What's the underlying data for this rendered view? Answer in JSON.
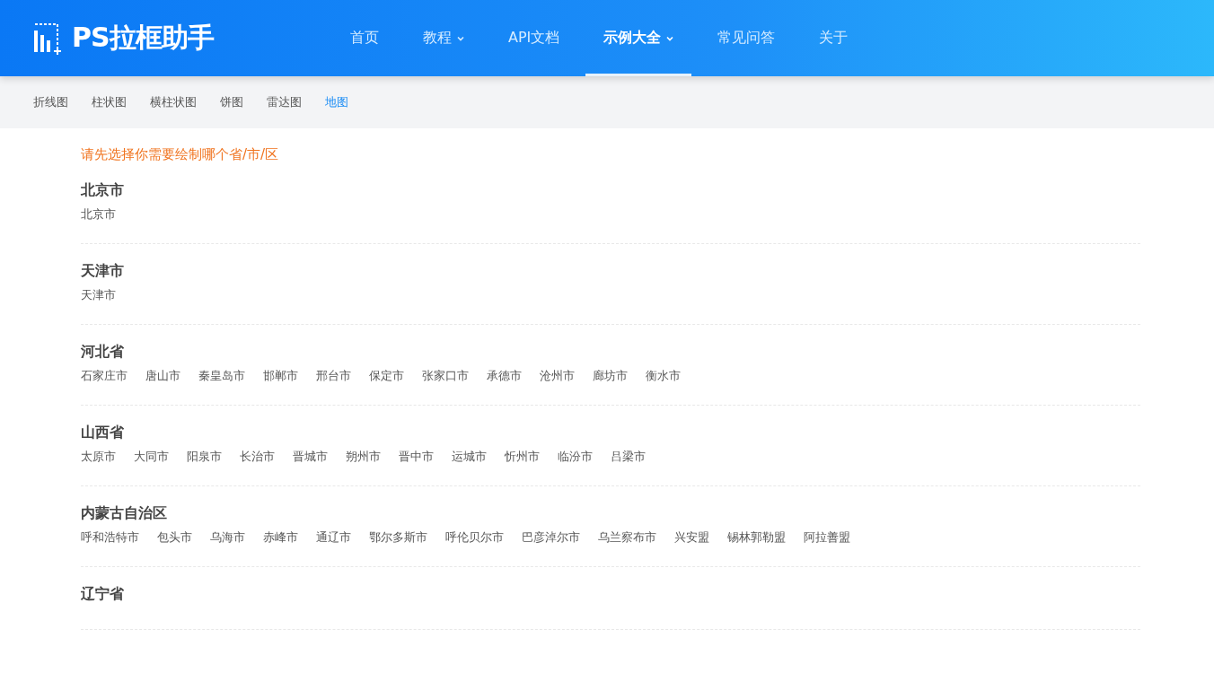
{
  "header": {
    "logo_text": "PS拉框助手",
    "nav": [
      {
        "label": "首页",
        "selected": false,
        "dropdown": false
      },
      {
        "label": "教程",
        "selected": false,
        "dropdown": true
      },
      {
        "label": "API文档",
        "selected": false,
        "dropdown": false
      },
      {
        "label": "示例大全",
        "selected": true,
        "dropdown": true
      },
      {
        "label": "常见问答",
        "selected": false,
        "dropdown": false
      },
      {
        "label": "关于",
        "selected": false,
        "dropdown": false
      }
    ]
  },
  "subnav": [
    {
      "label": "折线图",
      "selected": false
    },
    {
      "label": "柱状图",
      "selected": false
    },
    {
      "label": "横柱状图",
      "selected": false
    },
    {
      "label": "饼图",
      "selected": false
    },
    {
      "label": "雷达图",
      "selected": false
    },
    {
      "label": "地图",
      "selected": true
    }
  ],
  "hint": "请先选择你需要绘制哪个省/市/区",
  "regions": [
    {
      "name": "北京市",
      "cities": [
        "北京市"
      ]
    },
    {
      "name": "天津市",
      "cities": [
        "天津市"
      ]
    },
    {
      "name": "河北省",
      "cities": [
        "石家庄市",
        "唐山市",
        "秦皇岛市",
        "邯郸市",
        "邢台市",
        "保定市",
        "张家口市",
        "承德市",
        "沧州市",
        "廊坊市",
        "衡水市"
      ]
    },
    {
      "name": "山西省",
      "cities": [
        "太原市",
        "大同市",
        "阳泉市",
        "长治市",
        "晋城市",
        "朔州市",
        "晋中市",
        "运城市",
        "忻州市",
        "临汾市",
        "吕梁市"
      ]
    },
    {
      "name": "内蒙古自治区",
      "cities": [
        "呼和浩特市",
        "包头市",
        "乌海市",
        "赤峰市",
        "通辽市",
        "鄂尔多斯市",
        "呼伦贝尔市",
        "巴彦淖尔市",
        "乌兰察布市",
        "兴安盟",
        "锡林郭勒盟",
        "阿拉善盟"
      ]
    },
    {
      "name": "辽宁省"
    }
  ]
}
